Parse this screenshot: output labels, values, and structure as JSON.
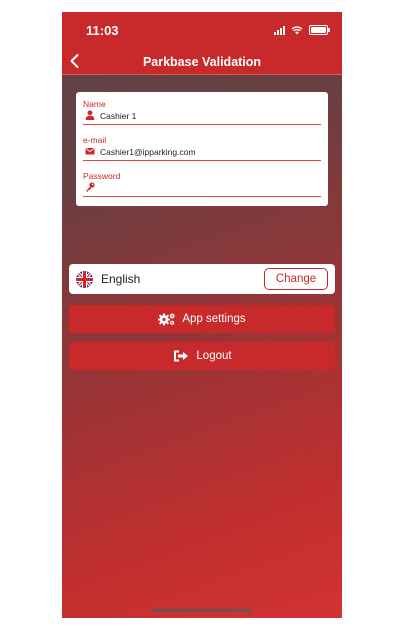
{
  "status_bar": {
    "time": "11:03"
  },
  "nav": {
    "title": "Parkbase Validation"
  },
  "form": {
    "name": {
      "label": "Name",
      "value": "Cashier 1",
      "icon": "user-icon"
    },
    "email": {
      "label": "e-mail",
      "value": "Cashier1@ipparking.com",
      "icon": "envelope-icon"
    },
    "password": {
      "label": "Password",
      "value": "",
      "icon": "key-icon"
    }
  },
  "language": {
    "current": "English",
    "change_label": "Change",
    "flag": "uk-flag-icon"
  },
  "buttons": {
    "settings_label": "App settings",
    "logout_label": "Logout"
  },
  "colors": {
    "primary": "#c8292b",
    "card": "#ffffff"
  }
}
